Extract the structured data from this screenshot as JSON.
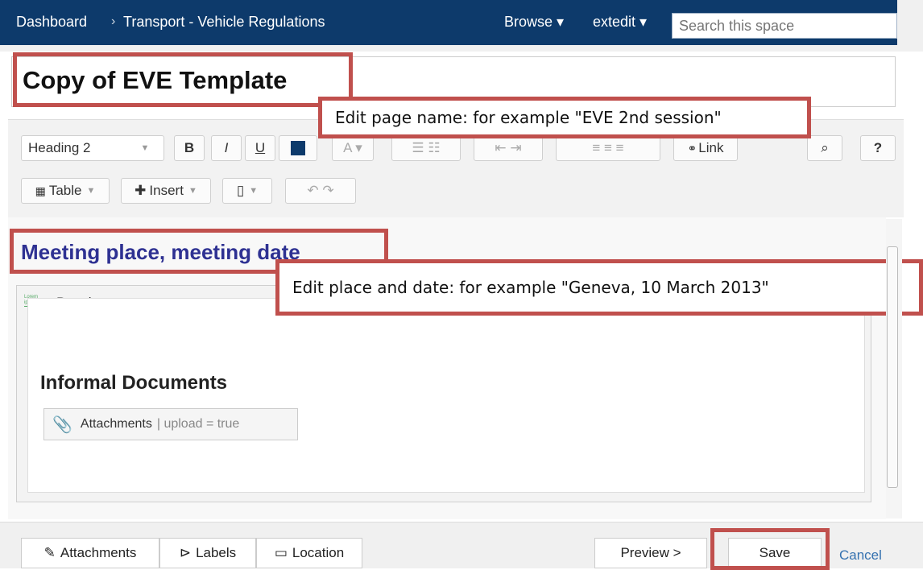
{
  "nav": {
    "crumbs": [
      "Dashboard",
      "Transport - Vehicle Regulations"
    ],
    "separator": "›",
    "browse": "Browse ▾",
    "user": "extedit ▾",
    "search_placeholder": "Search this space"
  },
  "title": "Copy of EVE Template",
  "callouts": {
    "title_hint": "Edit page name: for example \"EVE 2nd session\"",
    "place_hint": "Edit place and date: for example \"Geneva, 10 March 2013\""
  },
  "toolbar": {
    "style_select": "Heading 2",
    "bold": "B",
    "italic": "I",
    "underline": "U",
    "link": "Link",
    "help": "?",
    "table": "Table",
    "insert": "Insert"
  },
  "content": {
    "heading": "Meeting place, meeting date",
    "panel_label": "Panel",
    "panel_icon_text": "Lorem ipsum",
    "informal_heading": "Informal Documents",
    "attachments_macro": "Attachments",
    "attachments_param": "| upload = true"
  },
  "footer": {
    "attachments": "Attachments",
    "labels": "Labels",
    "location": "Location",
    "preview": "Preview >",
    "save": "Save",
    "cancel": "Cancel"
  },
  "colors": {
    "nav_bg": "#0d3a6b",
    "heading_blue": "#2e3192",
    "callout_border": "#c0504d",
    "link_blue": "#3572b0"
  }
}
